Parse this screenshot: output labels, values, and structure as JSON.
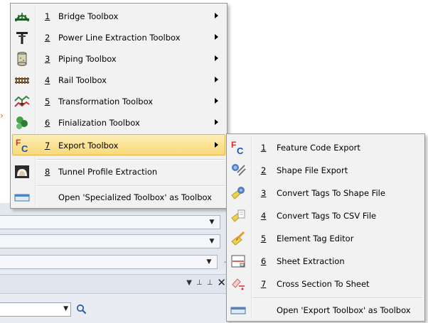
{
  "main_menu": {
    "items": [
      {
        "num": "1",
        "label": "Bridge Toolbox",
        "icon": "bridge-icon",
        "submenu": true
      },
      {
        "num": "2",
        "label": "Power Line Extraction Toolbox",
        "icon": "power-pole-icon",
        "submenu": true
      },
      {
        "num": "3",
        "label": "Piping Toolbox",
        "icon": "pipe-icon",
        "submenu": true
      },
      {
        "num": "4",
        "label": "Rail Toolbox",
        "icon": "rail-icon",
        "submenu": true
      },
      {
        "num": "5",
        "label": "Transformation Toolbox",
        "icon": "transformation-icon",
        "submenu": true
      },
      {
        "num": "6",
        "label": "Finialization Toolbox",
        "icon": "finalization-icon",
        "submenu": true
      },
      {
        "num": "7",
        "label": "Export Toolbox",
        "icon": "feature-code-icon",
        "submenu": true,
        "highlighted": true
      },
      {
        "num": "8",
        "label": "Tunnel Profile Extraction",
        "icon": "tunnel-icon",
        "submenu": false
      }
    ],
    "open_as_toolbox": {
      "label": "Open 'Specialized Toolbox' as Toolbox",
      "icon": "toolbox-window-icon"
    }
  },
  "export_submenu": {
    "items": [
      {
        "num": "1",
        "label": "Feature Code Export",
        "icon": "feature-code-icon"
      },
      {
        "num": "2",
        "label": "Shape File Export",
        "icon": "shape-file-icon"
      },
      {
        "num": "3",
        "label": "Convert Tags To Shape File",
        "icon": "tags-to-shape-icon"
      },
      {
        "num": "4",
        "label": "Convert Tags To CSV File",
        "icon": "tags-to-csv-icon"
      },
      {
        "num": "5",
        "label": "Element Tag Editor",
        "icon": "tag-editor-icon"
      },
      {
        "num": "6",
        "label": "Sheet Extraction",
        "icon": "sheet-extraction-icon"
      },
      {
        "num": "7",
        "label": "Cross Section To Sheet",
        "icon": "cross-section-icon"
      }
    ],
    "open_as_toolbox": {
      "label": "Open 'Export Toolbox' as Toolbox",
      "icon": "toolbox-window-icon"
    }
  },
  "colors": {
    "menu_bg": "#f2f2f2",
    "highlight": "#f9d978",
    "highlight_border": "#e3b34a",
    "accent": "#f28a20"
  }
}
